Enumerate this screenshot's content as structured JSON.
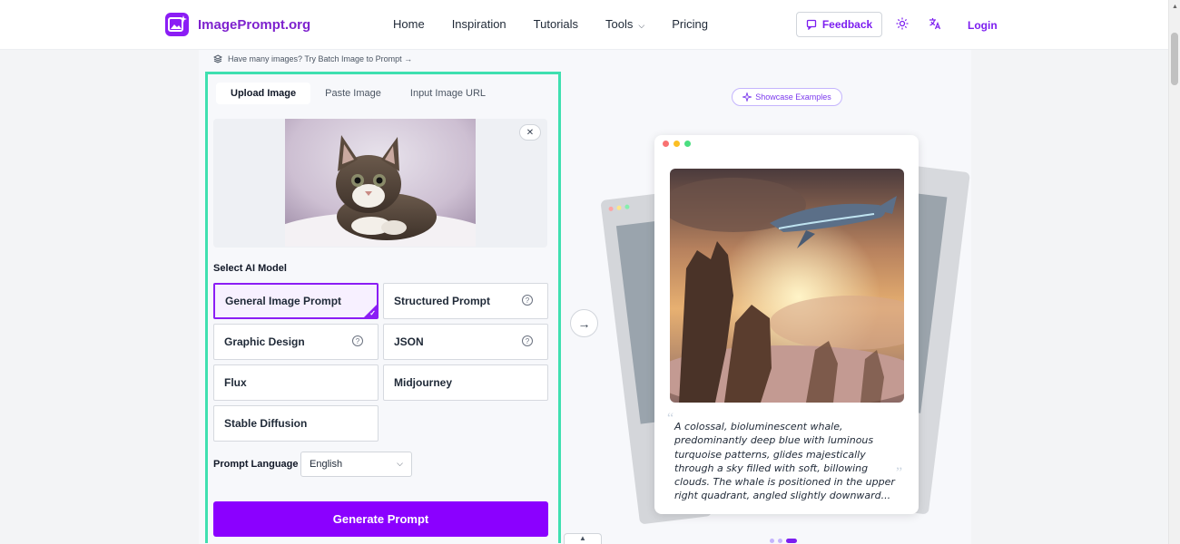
{
  "header": {
    "brand": "ImagePrompt.org",
    "nav": [
      "Home",
      "Inspiration",
      "Tutorials",
      "Tools",
      "Pricing"
    ],
    "feedback_label": "Feedback",
    "login_label": "Login",
    "brand_color": "#8b1df5"
  },
  "tool": {
    "batch_tip": "Have many images? Try Batch Image to Prompt →",
    "tabs": [
      "Upload Image",
      "Paste Image",
      "Input Image URL"
    ],
    "active_tab": "Upload Image",
    "select_model_label": "Select AI Model",
    "models": [
      {
        "label": "General Image Prompt",
        "selected": true,
        "help": false
      },
      {
        "label": "Structured Prompt",
        "selected": false,
        "help": true
      },
      {
        "label": "Graphic Design",
        "selected": false,
        "help": true
      },
      {
        "label": "JSON",
        "selected": false,
        "help": true
      },
      {
        "label": "Flux",
        "selected": false,
        "help": false
      },
      {
        "label": "Midjourney",
        "selected": false,
        "help": false
      },
      {
        "label": "Stable Diffusion",
        "selected": false,
        "help": false
      }
    ],
    "prompt_language_label": "Prompt Language",
    "prompt_language_value": "English",
    "generate_label": "Generate Prompt",
    "highlight_color": "#3fe0b0"
  },
  "showcase": {
    "pill_label": "Showcase Examples",
    "example_prompt": "A colossal, bioluminescent whale, predominantly deep blue with luminous turquoise patterns, glides majestically through a sky filled with soft, billowing clouds. The whale is positioned in the upper right quadrant, angled slightly downward...",
    "pager_count": 3,
    "pager_active": 3
  }
}
